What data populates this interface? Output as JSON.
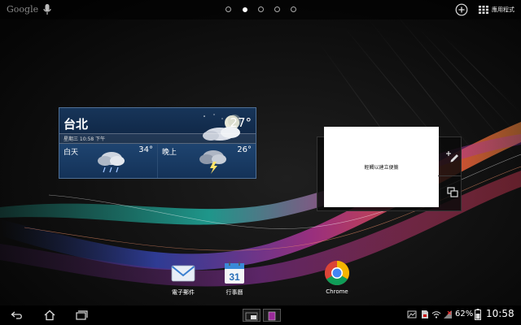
{
  "top_bar": {
    "search_brand": "Google",
    "page_count": 5,
    "active_page": 2,
    "apps_label": "應用程式"
  },
  "weather": {
    "city": "台北",
    "current_temp": "27°",
    "date_time": "星期三 10:58 下午",
    "day": {
      "label": "白天",
      "temp": "34°",
      "icon": "thunderstorm-cloud-icon"
    },
    "night": {
      "label": "晚上",
      "temp": "26°",
      "icon": "lightning-cloud-icon"
    }
  },
  "widget_placeholder": {
    "hint": "輕觸以建立便籤"
  },
  "dock": [
    {
      "label": "電子郵件",
      "icon": "email-icon"
    },
    {
      "label": "行事曆",
      "icon": "calendar-icon",
      "badge": "31"
    },
    {
      "label": "Chrome",
      "icon": "chrome-icon"
    }
  ],
  "status": {
    "battery_percent": "62%",
    "time": "10:58"
  },
  "colors": {
    "weather_border": "#4f6f95",
    "weather_bg": "#142c4c",
    "bar_bg": "#000000"
  }
}
